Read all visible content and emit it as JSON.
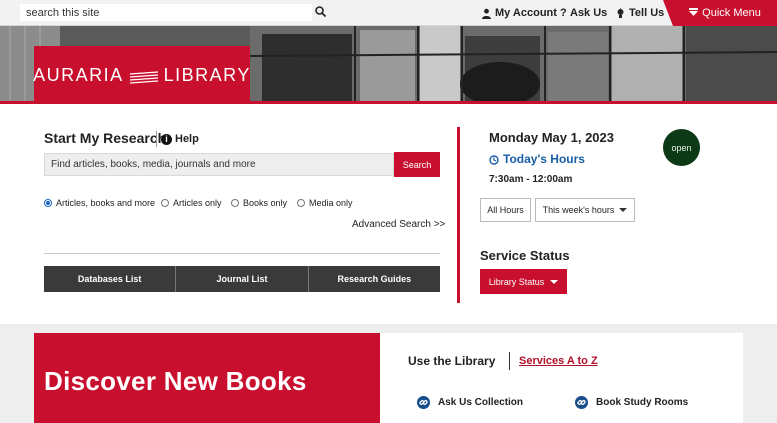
{
  "topbar": {
    "search_placeholder": "search this site",
    "my_account": "My Account",
    "ask_us": "Ask Us",
    "tell_us": "Tell Us",
    "quick_menu": "Quick Menu"
  },
  "logo": {
    "left": "AURARIA",
    "right": "LIBRARY"
  },
  "research": {
    "title": "Start My Research",
    "help": "Help",
    "search_placeholder": "Find articles, books, media, journals and more",
    "search_button": "Search",
    "options": [
      "Articles, books and more",
      "Articles only",
      "Books only",
      "Media only"
    ],
    "selected_option": "Articles, books and more",
    "advanced": "Advanced Search >>",
    "links": [
      "Databases List",
      "Journal List",
      "Research Guides"
    ]
  },
  "hours": {
    "date": "Monday May 1, 2023",
    "status": "open",
    "todays_hours_label": "Today's Hours",
    "todays_hours_value": "7:30am - 12:00am",
    "all_hours": "All Hours",
    "this_week": "This week's hours"
  },
  "service": {
    "title": "Service Status",
    "button": "Library Status"
  },
  "discover": {
    "title": "Discover New Books"
  },
  "use_library": {
    "title": "Use the Library",
    "services_link": "Services A to Z",
    "links": [
      "Ask Us Collection",
      "Book Study Rooms"
    ]
  },
  "colors": {
    "brand_red": "#c8102e",
    "link_blue": "#1a5ea8",
    "open_green": "#0d3a16"
  }
}
